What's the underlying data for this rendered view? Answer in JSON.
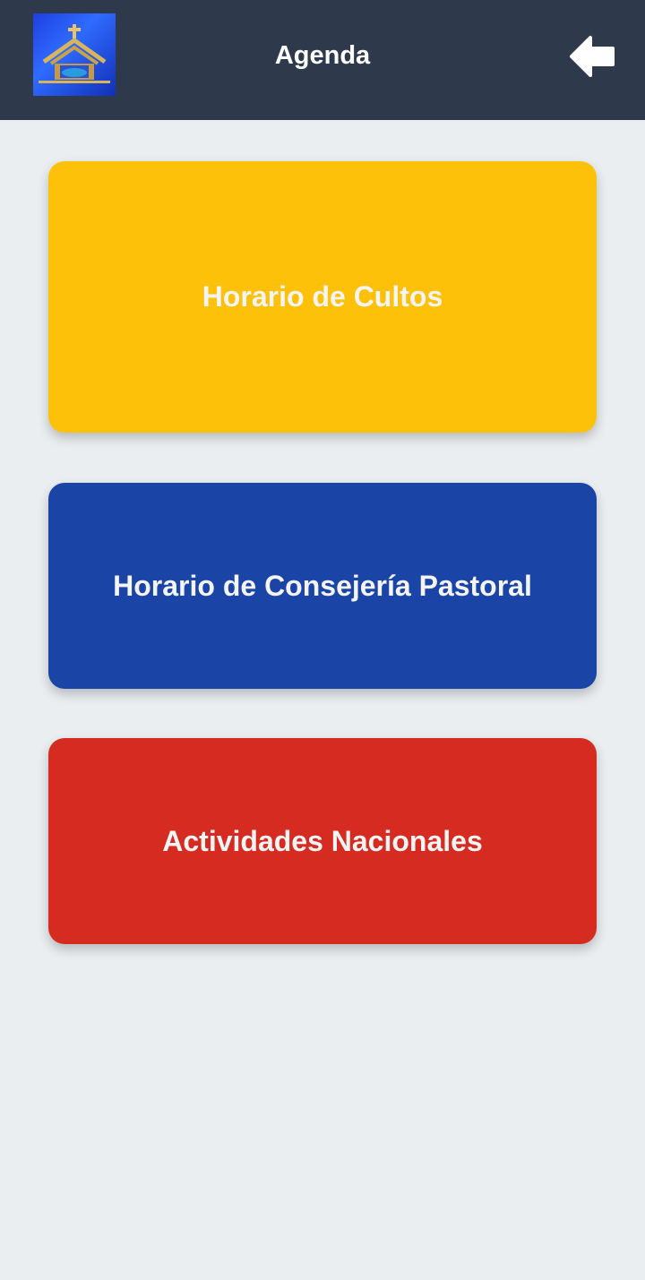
{
  "header": {
    "title": "Agenda",
    "logo_icon": "church-logo-icon",
    "back_icon": "arrow-left-icon",
    "background_color": "#2e3a4c"
  },
  "menu": {
    "items": [
      {
        "label": "Horario de Cultos",
        "color": "#fdc10a"
      },
      {
        "label": "Horario de Consejería Pastoral",
        "color": "#1a44a6"
      },
      {
        "label": "Actividades Nacionales",
        "color": "#d62b20"
      }
    ]
  },
  "page": {
    "background_color": "#eaeef0"
  }
}
